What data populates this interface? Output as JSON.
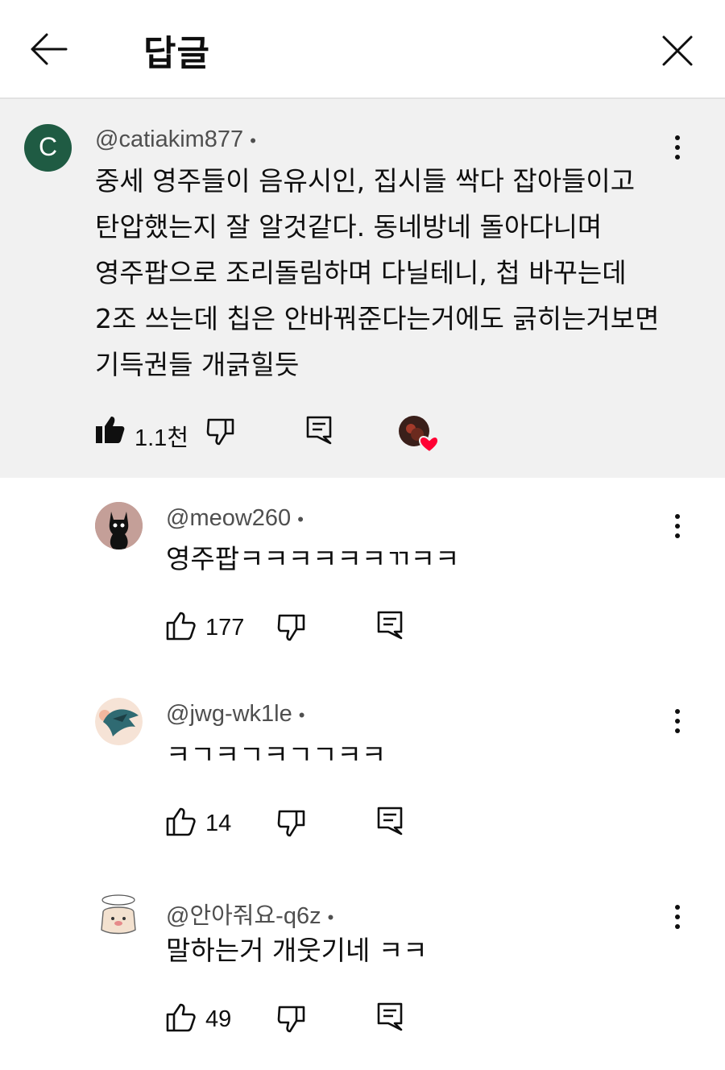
{
  "header": {
    "title": "답글"
  },
  "parent_comment": {
    "avatar_letter": "C",
    "avatar_color": "#1f5b43",
    "handle": "@catiakim877",
    "separator": "•",
    "text": "중세 영주들이 음유시인, 집시들 싹다 잡아들이고\n탄압했는지 잘 알것같다. 동네방네 돌아다니며\n영주팝으로 조리돌림하며 다닐테니, 첩 바꾸는데\n2조 쓰는데 칩은 안바꿔준다는거에도 긁히는거보면\n기득권들 개긁힐듯",
    "likes": "1.1천",
    "liked": true,
    "creator_heart": true
  },
  "replies": [
    {
      "handle": "@meow260",
      "separator": "•",
      "text": "영주팝ㅋㅋㅋㅋㅋㅋㄲㅋㅋ",
      "likes": "177",
      "avatar": "black-cat-avatar"
    },
    {
      "handle": "@jwg-wk1le",
      "separator": "•",
      "text": "ㅋㄱㅋㄱㅋㄱㄱㅋㅋ",
      "likes": "14",
      "avatar": "bird-avatar"
    },
    {
      "handle": "@안아줘요-q6z",
      "separator": "•",
      "text": "말하는거 개웃기네 ㅋㅋ",
      "likes": "49",
      "avatar": "bear-avatar"
    }
  ],
  "colors": {
    "parent_bg": "#f1f1f1",
    "heart": "#ff0033",
    "text": "#0f0f0f",
    "secondary": "#4f4f4f"
  }
}
